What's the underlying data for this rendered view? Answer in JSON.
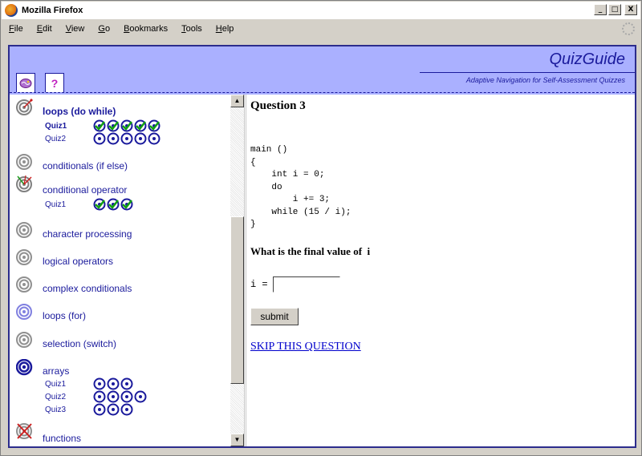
{
  "window": {
    "title": "Mozilla Firefox",
    "buttons": {
      "minimize": "_",
      "maximize": "□",
      "close": "X"
    }
  },
  "menu": [
    {
      "key": "F",
      "rest": "ile"
    },
    {
      "key": "E",
      "rest": "dit"
    },
    {
      "key": "V",
      "rest": "iew"
    },
    {
      "key": "G",
      "rest": "o"
    },
    {
      "key": "B",
      "rest": "ookmarks"
    },
    {
      "key": "T",
      "rest": "ools"
    },
    {
      "key": "H",
      "rest": "elp"
    }
  ],
  "header": {
    "brand": "QuizGuide",
    "tagline": "Adaptive Navigation for Self-Assessment Quizzes",
    "tabs": {
      "topics_icon": "brain-icon",
      "help": "?"
    }
  },
  "topics": {
    "loops_do_while": {
      "name": "loops (do while)",
      "quizzes": [
        {
          "label": "Quiz1"
        },
        {
          "label": "Quiz2"
        }
      ]
    },
    "conditionals_if_else": {
      "name": "conditionals (if else)"
    },
    "conditional_operator": {
      "name": "conditional operator",
      "quizzes": [
        {
          "label": "Quiz1"
        }
      ]
    },
    "character_processing": {
      "name": "character processing"
    },
    "logical_operators": {
      "name": "logical operators"
    },
    "complex_conditionals": {
      "name": "complex conditionals"
    },
    "loops_for": {
      "name": "loops (for)"
    },
    "selection_switch": {
      "name": "selection (switch)"
    },
    "arrays": {
      "name": "arrays",
      "quizzes": [
        {
          "label": "Quiz1"
        },
        {
          "label": "Quiz2"
        },
        {
          "label": "Quiz3"
        }
      ]
    },
    "functions": {
      "name": "functions"
    }
  },
  "question": {
    "title": "Question 3",
    "code": "main ()\n{\n    int i = 0;\n    do\n        i += 3;\n    while (15 / i);\n}",
    "prompt": "What is the final value of  i",
    "answer_label": "i =",
    "answer_value": "",
    "submit_label": "submit",
    "skip_label": "SKIP THIS QUESTION"
  },
  "colors": {
    "accent": "#1a1a9c",
    "header_bg": "#aab0ff",
    "link": "#0000cc"
  }
}
